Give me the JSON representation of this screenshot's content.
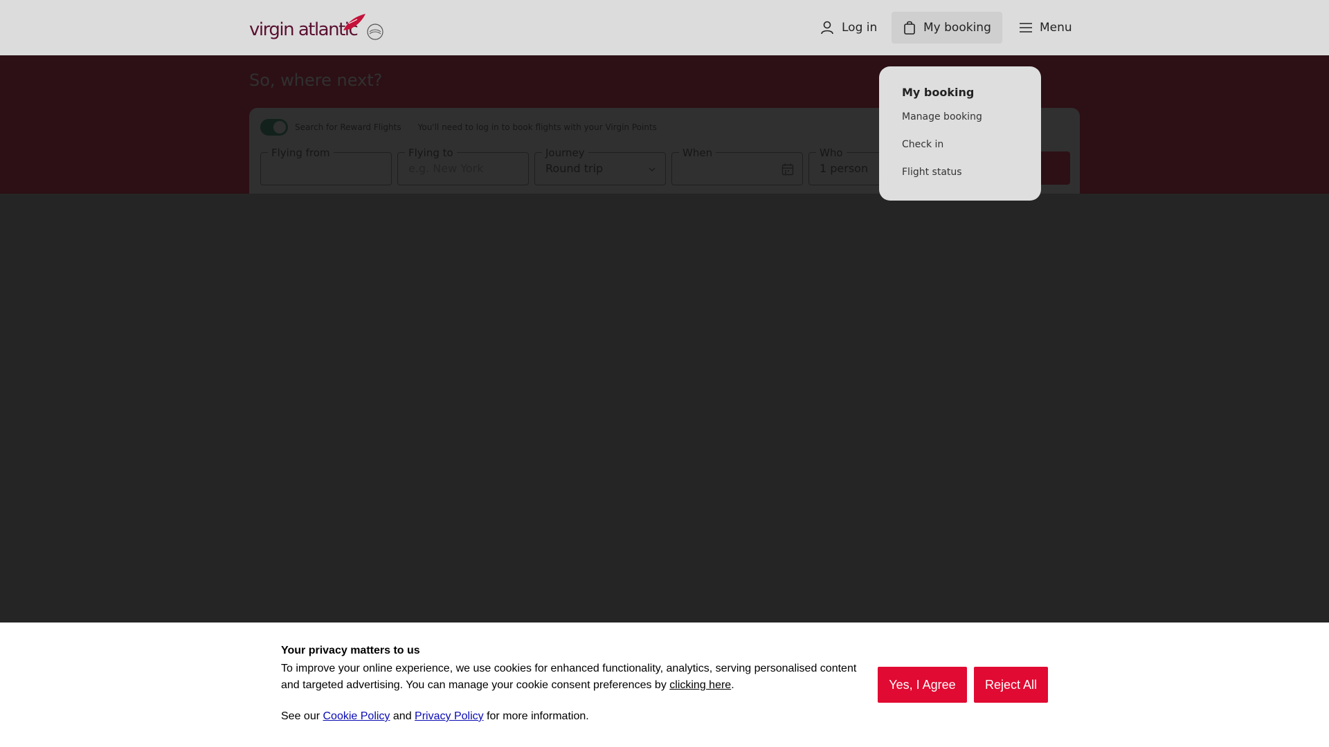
{
  "header": {
    "logo_text": "virgin atlantic",
    "login_label": "Log in",
    "my_booking_label": "My booking",
    "menu_label": "Menu"
  },
  "hero": {
    "title": "So, where next?",
    "reward_label": "Search for Reward Flights",
    "reward_note": "You'll need to log in to book flights with your Virgin Points",
    "fields": {
      "flying_from": {
        "label": "Flying from",
        "value": ""
      },
      "flying_to": {
        "label": "Flying to",
        "placeholder": "e.g. New York"
      },
      "journey": {
        "label": "Journey",
        "value": "Round trip"
      },
      "when": {
        "label": "When",
        "value": ""
      },
      "who": {
        "label": "Who",
        "value": "1 person"
      }
    }
  },
  "dropdown": {
    "title": "My booking",
    "items": [
      "Manage booking",
      "Check in",
      "Flight status"
    ]
  },
  "cookie": {
    "title": "Your privacy matters to us",
    "body_text": "To improve your online experience, we use cookies for enhanced functionality, analytics, serving personalised content and targeted advertising. You can manage your cookie consent preferences by",
    "clicking_here": "clicking here",
    "body_end": ".",
    "see_our": "See our",
    "cookie_policy": "Cookie Policy",
    "and": "and",
    "privacy_policy": "Privacy Policy",
    "more_info": "for more information.",
    "agree_label": "Yes, I Agree",
    "reject_label": "Reject All"
  },
  "colors": {
    "brand_red": "#e10a32",
    "toggle_green": "#1d8d5c",
    "link_blue": "#0a0ab4"
  }
}
